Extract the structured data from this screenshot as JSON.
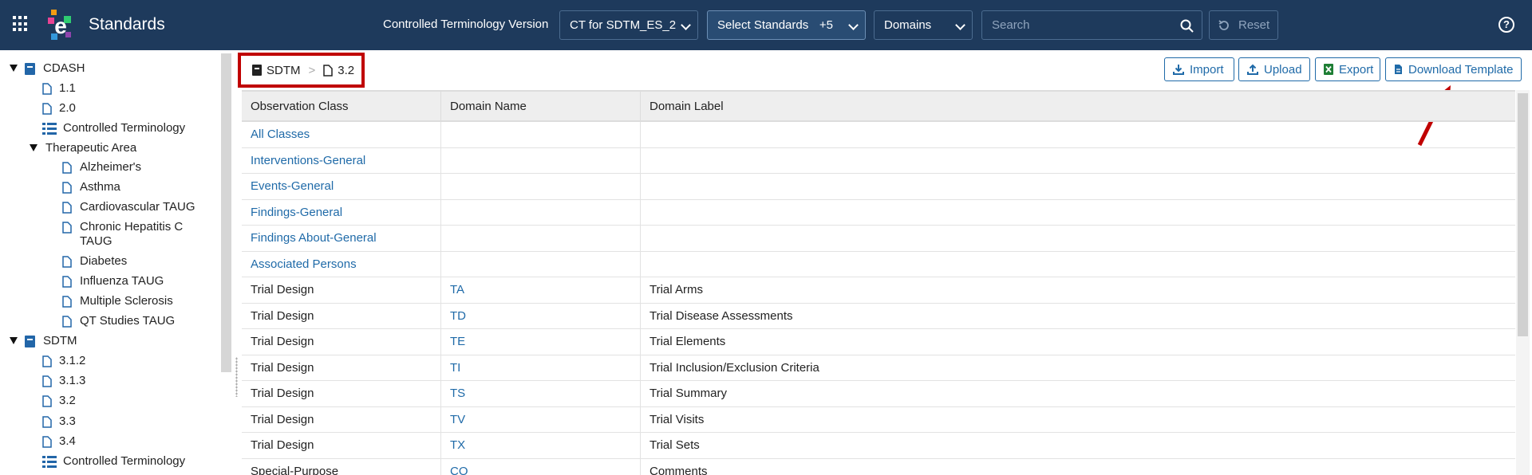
{
  "app": {
    "title": "Standards"
  },
  "toolbar": {
    "ct_label": "Controlled Terminology Version",
    "ct_value": "CT for SDTM_ES_2",
    "standards_value": "Select Standards",
    "standards_count": "+5",
    "domains_value": "Domains",
    "search_placeholder": "Search",
    "reset_label": "Reset",
    "help_label": "?"
  },
  "sidebar": {
    "cdash": {
      "label": "CDASH",
      "versions": [
        "1.1",
        "2.0"
      ],
      "ct": "Controlled Terminology"
    },
    "ta": {
      "label": "Therapeutic Area",
      "items": [
        "Alzheimer's",
        "Asthma",
        "Cardiovascular TAUG",
        "Chronic Hepatitis C",
        "TAUG",
        "Diabetes",
        "Influenza TAUG",
        "Multiple Sclerosis",
        "QT Studies TAUG"
      ]
    },
    "sdtm": {
      "label": "SDTM",
      "versions": [
        "3.1.2",
        "3.1.3",
        "3.2",
        "3.3",
        "3.4"
      ],
      "ct": "Controlled Terminology"
    }
  },
  "breadcrumb": {
    "root": "SDTM",
    "sep": ">",
    "leaf": "3.2"
  },
  "actions": {
    "import": "Import",
    "upload": "Upload",
    "export": "Export",
    "download": "Download Template"
  },
  "table": {
    "headers": [
      "Observation Class",
      "Domain Name",
      "Domain Label"
    ],
    "rows": [
      {
        "cls": "All Classes",
        "name": "",
        "label": "",
        "cls_link": true
      },
      {
        "cls": "Interventions-General",
        "name": "",
        "label": "",
        "cls_link": true
      },
      {
        "cls": "Events-General",
        "name": "",
        "label": "",
        "cls_link": true
      },
      {
        "cls": "Findings-General",
        "name": "",
        "label": "",
        "cls_link": true
      },
      {
        "cls": "Findings About-General",
        "name": "",
        "label": "",
        "cls_link": true
      },
      {
        "cls": "Associated Persons",
        "name": "",
        "label": "",
        "cls_link": true
      },
      {
        "cls": "Trial Design",
        "name": "TA",
        "label": "Trial Arms",
        "cls_link": false
      },
      {
        "cls": "Trial Design",
        "name": "TD",
        "label": "Trial Disease Assessments",
        "cls_link": false
      },
      {
        "cls": "Trial Design",
        "name": "TE",
        "label": "Trial Elements",
        "cls_link": false
      },
      {
        "cls": "Trial Design",
        "name": "TI",
        "label": "Trial Inclusion/Exclusion Criteria",
        "cls_link": false
      },
      {
        "cls": "Trial Design",
        "name": "TS",
        "label": "Trial Summary",
        "cls_link": false
      },
      {
        "cls": "Trial Design",
        "name": "TV",
        "label": "Trial Visits",
        "cls_link": false
      },
      {
        "cls": "Trial Design",
        "name": "TX",
        "label": "Trial Sets",
        "cls_link": false
      },
      {
        "cls": "Special-Purpose",
        "name": "CO",
        "label": "Comments",
        "cls_link": false
      }
    ]
  },
  "colors": {
    "topbar": "#1e3a5c",
    "link": "#1f6aa8",
    "highlight": "#c00000"
  }
}
